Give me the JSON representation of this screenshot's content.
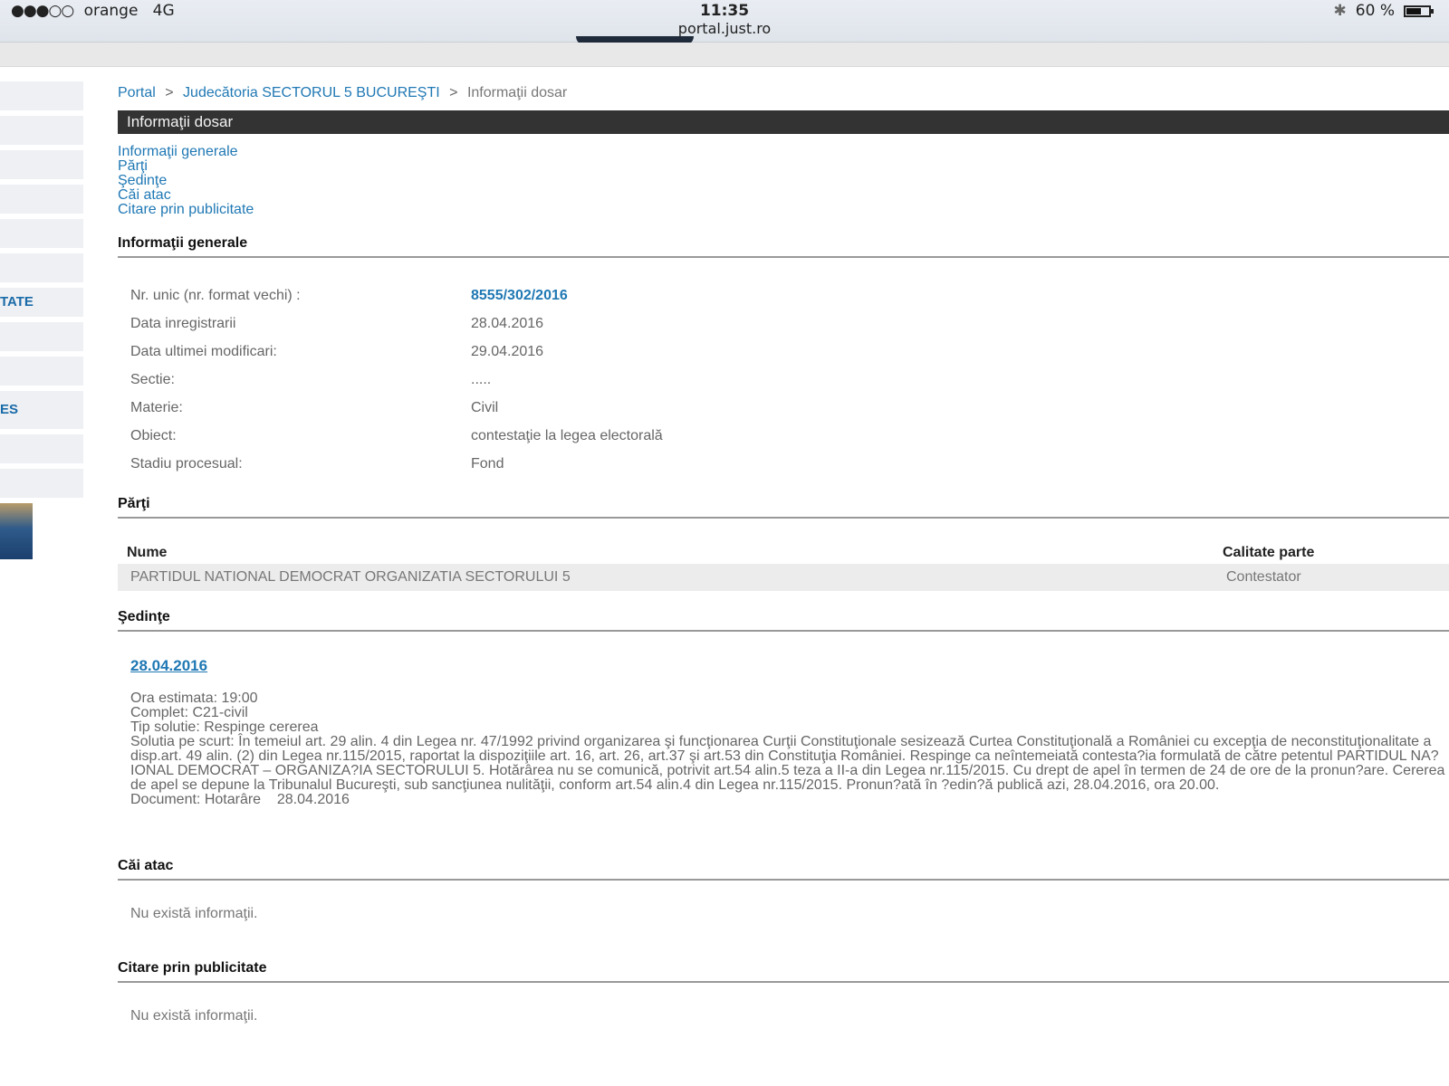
{
  "status_bar": {
    "signal": "●●●○○",
    "carrier": "orange",
    "network": "4G",
    "time": "11:35",
    "url": "portal.just.ro",
    "bluetooth": "✱",
    "battery_text": "60 %",
    "battery_level": 0.6
  },
  "sidebar": {
    "items": [
      "",
      "",
      "",
      "",
      "",
      "",
      "TATE",
      "",
      "",
      "ES",
      "",
      ""
    ]
  },
  "breadcrumb": {
    "items": [
      "Portal",
      "Judecătoria SECTORUL 5 BUCUREŞTI",
      "Informaţii dosar"
    ],
    "separator": ">"
  },
  "title": "Informaţii dosar",
  "toc": [
    "Informaţii generale",
    "Părţi",
    "Şedinţe",
    "Căi atac",
    "Citare prin publicitate"
  ],
  "general": {
    "heading": "Informaţii generale",
    "rows": [
      {
        "key": "Nr. unic (nr. format vechi) :",
        "value": "8555/302/2016",
        "link": true
      },
      {
        "key": "Data inregistrarii",
        "value": "28.04.2016"
      },
      {
        "key": "Data ultimei modificari:",
        "value": "29.04.2016"
      },
      {
        "key": "Sectie:",
        "value": "....."
      },
      {
        "key": "Materie:",
        "value": "Civil"
      },
      {
        "key": "Obiect:",
        "value": "contestaţie la legea electorală"
      },
      {
        "key": "Stadiu procesual:",
        "value": "Fond"
      }
    ]
  },
  "parti": {
    "heading": "Părţi",
    "columns": [
      "Nume",
      "Calitate parte"
    ],
    "rows": [
      [
        "PARTIDUL NATIONAL DEMOCRAT ORGANIZATIA SECTORULUI 5",
        "Contestator"
      ]
    ]
  },
  "sedinte": {
    "heading": "Şedinţe",
    "date": "28.04.2016",
    "lines": [
      "Ora estimata: 19:00",
      "Complet: C21-civil",
      "Tip solutie: Respinge cererea",
      "Solutia pe scurt: În temeiul art. 29 alin. 4 din Legea nr. 47/1992 privind organizarea şi funcţionarea Curţii Constituţionale sesizează Curtea Constituţională a României cu excepţia de neconstituţionalitate a disp.art. 49 alin. (2) din Legea nr.115/2015, raportat la dispoziţiile art. 16, art. 26, art.37 şi art.53 din Constituţia României. Respinge ca neîntemeiată contesta?ia formulată de către petentul PARTIDUL NA?IONAL DEMOCRAT – ORGANIZA?IA SECTORULUI 5. Hotărârea nu se comunică, potrivit art.54 alin.5 teza a II-a din Legea nr.115/2015. Cu drept de apel în termen de 24 de ore de la pronun?are. Cererea de apel se depune la Tribunalul Bucureşti, sub sancţiunea nulităţii, conform art.54 alin.4 din Legea nr.115/2015. Pronun?ată în ?edin?ă publică azi, 28.04.2016, ora 20.00.",
      "Document: Hotarâre    28.04.2016"
    ]
  },
  "cai_atac": {
    "heading": "Căi atac",
    "message": "Nu există informaţii."
  },
  "citare": {
    "heading": "Citare prin publicitate",
    "message": "Nu există informaţii."
  }
}
